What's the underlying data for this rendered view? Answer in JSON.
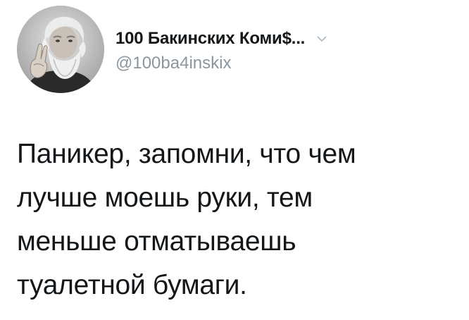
{
  "tweet": {
    "author": {
      "display_name": "100 Бакинских Коми$...",
      "handle": "@100ba4inskix",
      "avatar_icon": "bearded-man-avatar"
    },
    "menu_icon": "chevron-down-icon",
    "text": "Паникер, запомни, что чем\nлучше моешь руки, тем\nменьше отматываешь\nтуалетной бумаги."
  },
  "colors": {
    "text": "#14171a",
    "secondary": "#8a959e",
    "background": "#ffffff"
  }
}
